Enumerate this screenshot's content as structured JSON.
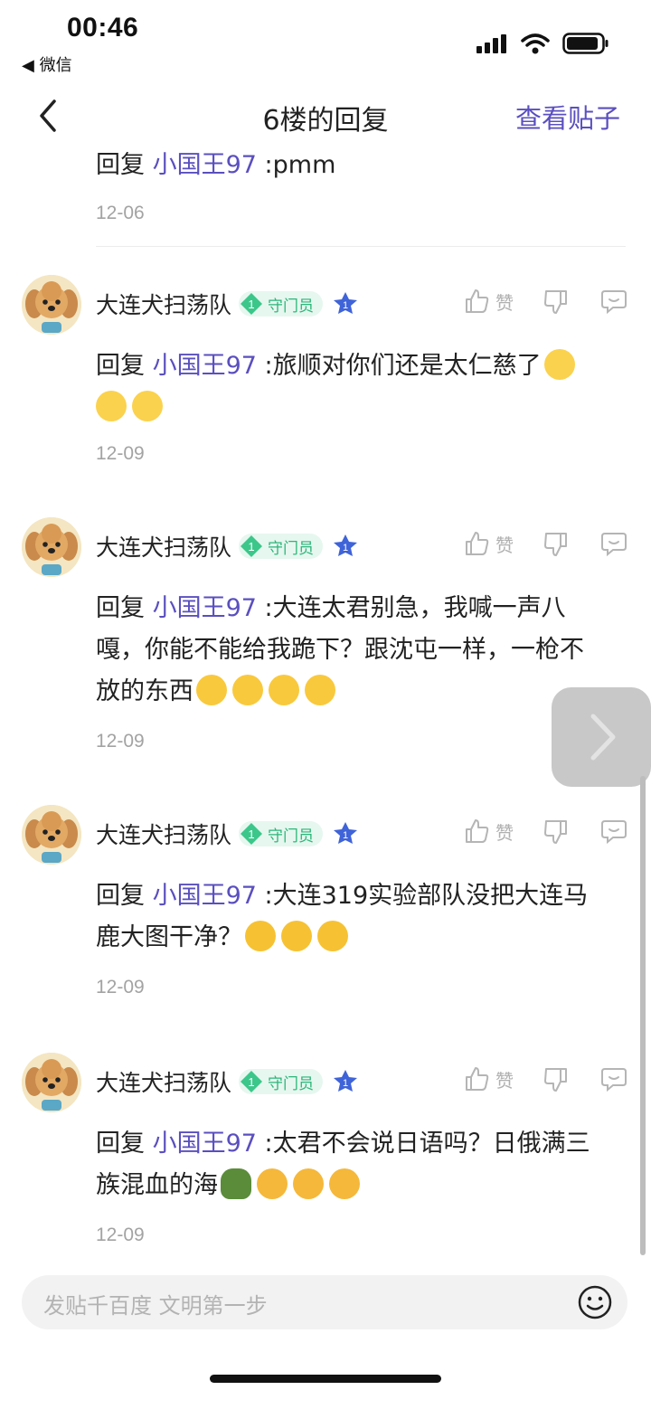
{
  "statusbar": {
    "time": "00:46",
    "back_app": "◀ 微信",
    "icons": [
      "signal-icon",
      "wifi-icon",
      "battery-icon"
    ]
  },
  "nav": {
    "title": "6楼的回复",
    "view_post": "查看贴子"
  },
  "colors": {
    "accent": "#5a4fbf",
    "badge_green": "#2db57a",
    "date_gray": "#a3a3a3"
  },
  "top_partial": {
    "reply_prefix": "回复",
    "mention": "小国王97",
    "text": " :pmm",
    "date": "12-06"
  },
  "comments": [
    {
      "user": "大连犬扫荡队",
      "badge_level": "1",
      "badge": "守门员",
      "star_level": "1",
      "like_label": "赞",
      "reply_prefix": "回复",
      "mention": "小国王97",
      "text": " :旅顺对你们还是太仁慈了",
      "emojis": [
        "grin-emoji",
        "grin-emoji",
        "grin-emoji"
      ],
      "date": "12-09"
    },
    {
      "user": "大连犬扫荡队",
      "badge_level": "1",
      "badge": "守门员",
      "star_level": "1",
      "like_label": "赞",
      "reply_prefix": "回复",
      "mention": "小国王97",
      "text_lines": [
        " :大连太君别急，我喊一声八",
        "嘎，你能不能给我跪下？跟沈屯一样，一枪不",
        "放的东西"
      ],
      "emojis": [
        "laugh-emoji",
        "laugh-emoji",
        "laugh-emoji",
        "laugh-emoji"
      ],
      "date": "12-09"
    },
    {
      "user": "大连犬扫荡队",
      "badge_level": "1",
      "badge": "守门员",
      "star_level": "1",
      "like_label": "赞",
      "reply_prefix": "回复",
      "mention": "小国王97",
      "text_lines": [
        " :大连319实验部队没把大连马",
        "鹿大图干净？"
      ],
      "emojis": [
        "cover-mouth-emoji",
        "cover-mouth-emoji",
        "cover-mouth-emoji"
      ],
      "date": "12-09"
    },
    {
      "user": "大连犬扫荡队",
      "badge_level": "1",
      "badge": "守门员",
      "star_level": "1",
      "like_label": "赞",
      "reply_prefix": "回复",
      "mention": "小国王97",
      "text_lines": [
        " :太君不会说日语吗？日俄满三",
        "族混血的海"
      ],
      "emojis": [
        "turtle-emoji",
        "heart-eyes-emoji",
        "heart-eyes-emoji",
        "heart-eyes-emoji"
      ],
      "date": "12-09"
    }
  ],
  "composer": {
    "placeholder": "发贴千百度 文明第一步"
  }
}
